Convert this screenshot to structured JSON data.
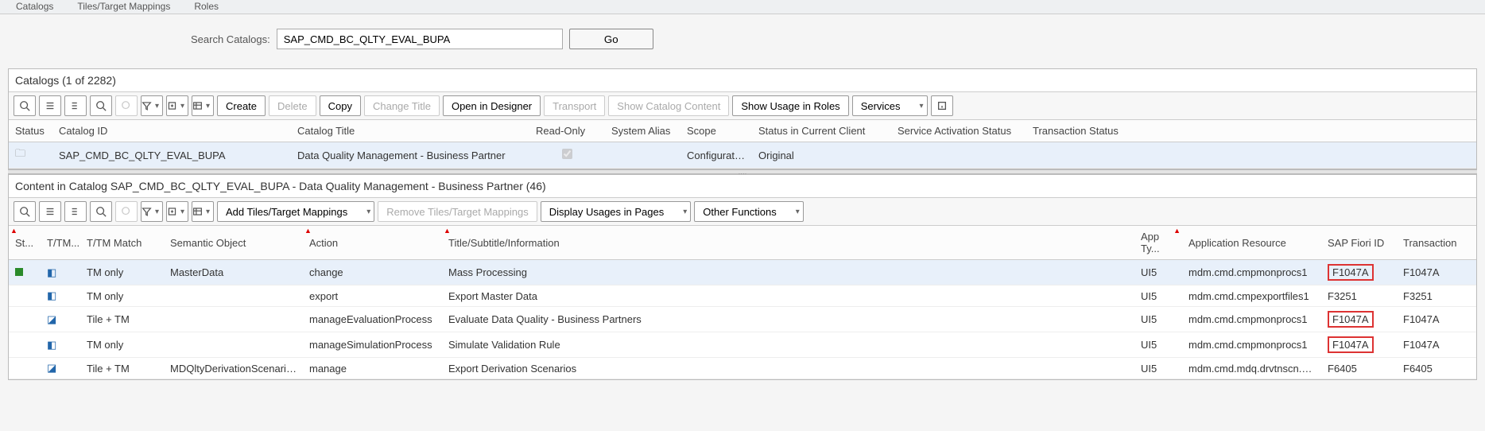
{
  "top_tabs": [
    "Catalogs",
    "Tiles/Target Mappings",
    "Roles"
  ],
  "search": {
    "label": "Search Catalogs:",
    "value": "SAP_CMD_BC_QLTY_EVAL_BUPA",
    "go": "Go"
  },
  "catalogs": {
    "title": "Catalogs (1 of 2282)",
    "buttons": {
      "create": "Create",
      "delete": "Delete",
      "copy": "Copy",
      "change_title": "Change Title",
      "open_designer": "Open in Designer",
      "transport": "Transport",
      "show_content": "Show Catalog Content",
      "show_usage": "Show Usage in Roles",
      "services": "Services"
    },
    "headers": [
      "Status",
      "Catalog ID",
      "Catalog Title",
      "Read-Only",
      "System Alias",
      "Scope",
      "Status in Current Client",
      "Service Activation Status",
      "Transaction Status"
    ],
    "row": {
      "catalog_id": "SAP_CMD_BC_QLTY_EVAL_BUPA",
      "catalog_title": "Data Quality Management - Business Partner",
      "scope": "Configuration",
      "status_client": "Original"
    }
  },
  "content": {
    "title": "Content in Catalog SAP_CMD_BC_QLTY_EVAL_BUPA - Data Quality Management - Business Partner (46)",
    "buttons": {
      "add": "Add Tiles/Target Mappings",
      "remove": "Remove Tiles/Target Mappings",
      "usages": "Display Usages in Pages",
      "other": "Other Functions"
    },
    "headers": [
      "St...",
      "T/TM...",
      "T/TM Match",
      "Semantic Object",
      "Action",
      "Title/Subtitle/Information",
      "App Ty...",
      "Application Resource",
      "SAP Fiori ID",
      "Transaction"
    ],
    "rows": [
      {
        "st": true,
        "ic": "tm",
        "match": "TM only",
        "so": "MasterData",
        "action": "change",
        "title": "Mass Processing",
        "app": "UI5",
        "res": "mdm.cmd.cmpmonprocs1",
        "fiori": "F1047A",
        "trans": "F1047A",
        "hl": true,
        "sel": true
      },
      {
        "st": false,
        "ic": "tm",
        "match": "TM only",
        "so": "",
        "action": "export",
        "title": "Export Master Data",
        "app": "UI5",
        "res": "mdm.cmd.cmpexportfiles1",
        "fiori": "F3251",
        "trans": "F3251",
        "hl": false,
        "sel": false
      },
      {
        "st": false,
        "ic": "tile",
        "match": "Tile + TM",
        "so": "",
        "action": "manageEvaluationProcess",
        "title": "Evaluate Data Quality - Business Partners",
        "app": "UI5",
        "res": "mdm.cmd.cmpmonprocs1",
        "fiori": "F1047A",
        "trans": "F1047A",
        "hl": true,
        "sel": false
      },
      {
        "st": false,
        "ic": "tm",
        "match": "TM only",
        "so": "",
        "action": "manageSimulationProcess",
        "title": "Simulate Validation Rule",
        "app": "UI5",
        "res": "mdm.cmd.cmpmonprocs1",
        "fiori": "F1047A",
        "trans": "F1047A",
        "hl": true,
        "sel": false
      },
      {
        "st": false,
        "ic": "tile",
        "match": "Tile + TM",
        "so": "MDQltyDerivationScenarioE",
        "action": "manage",
        "title": "Export Derivation Scenarios",
        "app": "UI5",
        "res": "mdm.cmd.mdq.drvtnscn.exp",
        "fiori": "F6405",
        "trans": "F6405",
        "hl": false,
        "sel": false
      }
    ]
  }
}
